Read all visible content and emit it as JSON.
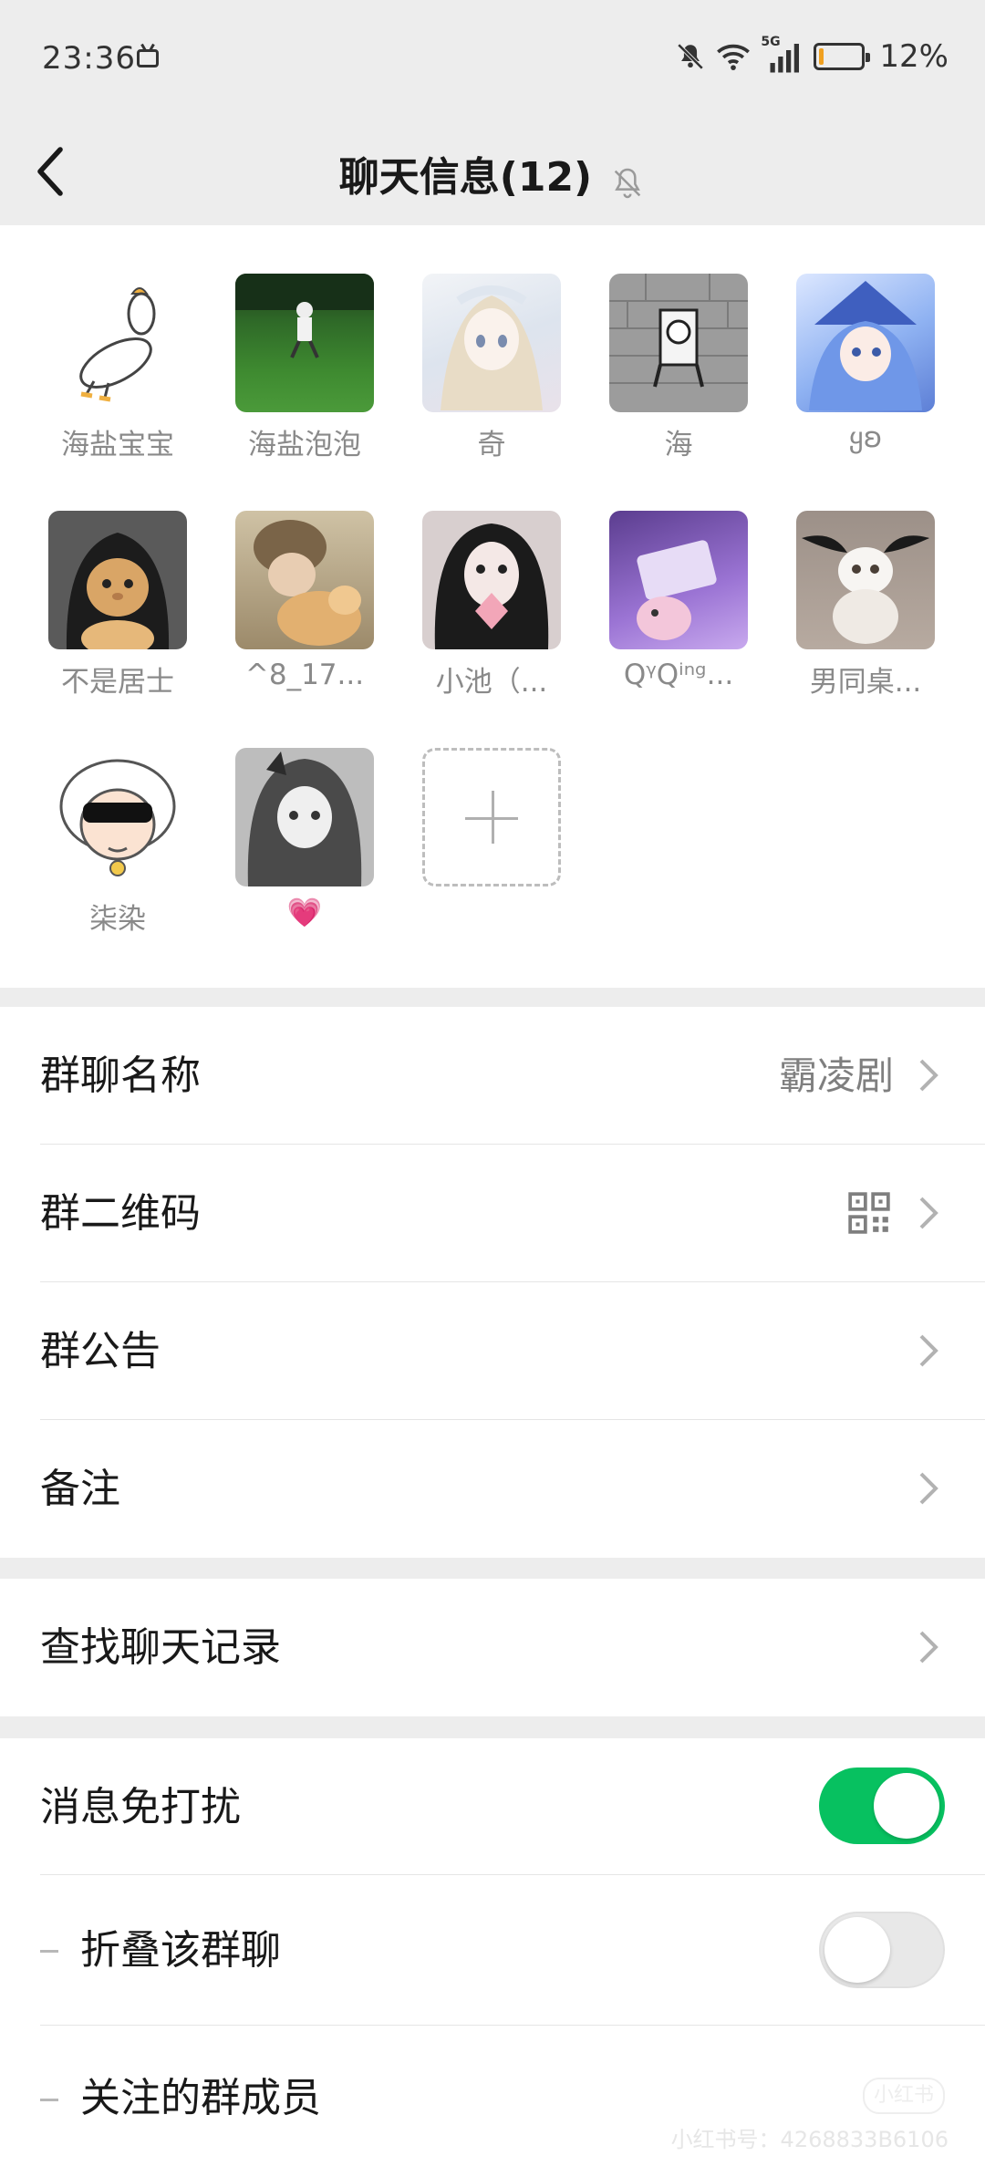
{
  "status_bar": {
    "time": "23:36",
    "network": "5G",
    "battery_percent": "12%",
    "battery_level": 0.12,
    "icons": [
      "tv-icon",
      "bell-muted-icon",
      "wifi-icon",
      "cellular-signal-icon",
      "battery-icon"
    ]
  },
  "nav": {
    "title": "聊天信息(12)",
    "back_icon": "chevron-left-icon",
    "mute_icon": "bell-muted-icon"
  },
  "members": [
    {
      "name": "海盐宝宝",
      "avatar": "white-duck-drawing"
    },
    {
      "name": "海盐泡泡",
      "avatar": "field-photo"
    },
    {
      "name": "奇",
      "avatar": "anime-girl-pastel"
    },
    {
      "name": "海",
      "avatar": "manga-character-gray"
    },
    {
      "name": "ყʚ",
      "avatar": "anime-girl-blue-hat"
    },
    {
      "name": "不是居士",
      "avatar": "cat-in-hood"
    },
    {
      "name": "^8_17...",
      "avatar": "person-with-cat"
    },
    {
      "name": "小池（...",
      "avatar": "girl-with-flower"
    },
    {
      "name": "QᵞQⁱⁿᵍ...",
      "avatar": "anime-purple"
    },
    {
      "name": "男同桌...",
      "avatar": "white-cat-wings"
    },
    {
      "name": "柒染",
      "avatar": "sheep-sunglasses"
    },
    {
      "name": "💗",
      "avatar": "anime-girl-bw"
    }
  ],
  "add_member_label": "+",
  "settings": {
    "group_name": {
      "label": "群聊名称",
      "value": "霸凌剧"
    },
    "group_qr": {
      "label": "群二维码"
    },
    "announcement": {
      "label": "群公告"
    },
    "remark": {
      "label": "备注"
    },
    "search_history": {
      "label": "查找聊天记录"
    },
    "do_not_disturb": {
      "label": "消息免打扰",
      "enabled": true
    },
    "fold_chat": {
      "label": "折叠该群聊",
      "enabled": false
    },
    "followed_members": {
      "label": "关注的群成员"
    }
  },
  "watermark": {
    "text": "小红书号：4268833B6106",
    "badge": "小红书"
  },
  "colors": {
    "accent": "#07c160",
    "background": "#ededed",
    "card": "#ffffff"
  }
}
